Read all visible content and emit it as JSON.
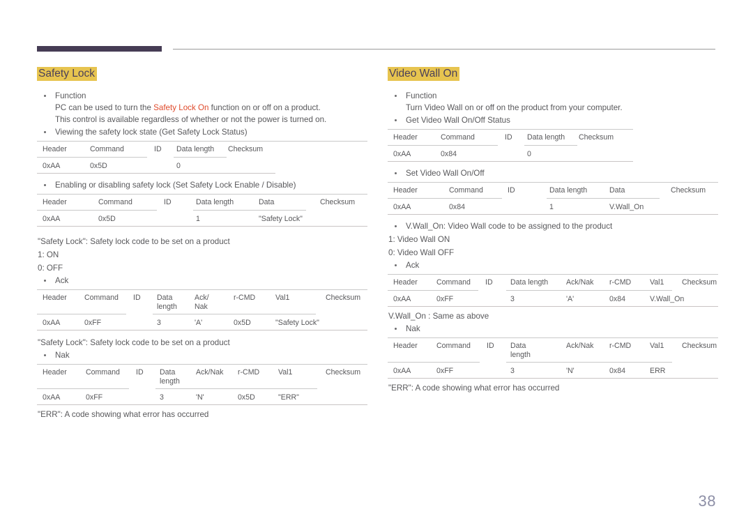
{
  "page": {
    "number": "38"
  },
  "left": {
    "heading": "Safety Lock",
    "function_label": "Function",
    "function_line1_a": "PC can be used to turn the ",
    "function_line1_hl": "Safety Lock On",
    "function_line1_b": " function on or off on a product.",
    "function_line2": "This control is available regardless of whether or not the power is turned on.",
    "get_label": "Viewing the safety lock state (Get Safety Lock Status)",
    "get_table": {
      "headers": [
        "Header",
        "Command",
        "ID",
        "Data length",
        "Checksum"
      ],
      "values": [
        "0xAA",
        "0x5D",
        "",
        "0",
        ""
      ]
    },
    "set_label": "Enabling or disabling safety lock (Set Safety Lock Enable / Disable)",
    "set_table": {
      "headers": [
        "Header",
        "Command",
        "ID",
        "Data length",
        "Data",
        "Checksum"
      ],
      "values": [
        "0xAA",
        "0x5D",
        "",
        "1",
        "\"Safety Lock\"",
        ""
      ]
    },
    "note_code_1": "\"Safety Lock\": Safety lock code to be set on a product",
    "note_on": "1: ON",
    "note_off": "0: OFF",
    "ack_label": "Ack",
    "ack_table": {
      "headers": [
        "Header",
        "Command",
        "ID",
        "Data\nlength",
        "Ack/\nNak",
        "r-CMD",
        "Val1",
        "Checksum"
      ],
      "values": [
        "0xAA",
        "0xFF",
        "",
        "3",
        "'A'",
        "0x5D",
        "\"Safety Lock\"",
        ""
      ]
    },
    "note_code_2": "\"Safety Lock\": Safety lock code to be set on a product",
    "nak_label": "Nak",
    "nak_table": {
      "headers": [
        "Header",
        "Command",
        "ID",
        "Data\nlength",
        "Ack/Nak",
        "r-CMD",
        "Val1",
        "Checksum"
      ],
      "values": [
        "0xAA",
        "0xFF",
        "",
        "3",
        "'N'",
        "0x5D",
        "\"ERR\"",
        ""
      ]
    },
    "note_err": "\"ERR\": A code showing what error has occurred"
  },
  "right": {
    "heading": "Video Wall On",
    "function_label": "Function",
    "function_line1": "Turn Video Wall on or off on the product from your computer.",
    "get_label": "Get Video Wall On/Off Status",
    "get_table": {
      "headers": [
        "Header",
        "Command",
        "ID",
        "Data length",
        "Checksum"
      ],
      "values": [
        "0xAA",
        "0x84",
        "",
        "0",
        ""
      ]
    },
    "set_label": "Set Video Wall On/Off",
    "set_table": {
      "headers": [
        "Header",
        "Command",
        "ID",
        "Data length",
        "Data",
        "Checksum"
      ],
      "values": [
        "0xAA",
        "0x84",
        "",
        "1",
        "V.Wall_On",
        ""
      ]
    },
    "vwall_label": "V.Wall_On: Video Wall code to be assigned to the product",
    "note_on": "1: Video Wall ON",
    "note_off": "0: Video Wall OFF",
    "ack_label": "Ack",
    "ack_table": {
      "headers": [
        "Header",
        "Command",
        "ID",
        "Data length",
        "Ack/Nak",
        "r-CMD",
        "Val1",
        "Checksum"
      ],
      "values": [
        "0xAA",
        "0xFF",
        "",
        "3",
        "'A'",
        "0x84",
        "V.Wall_On",
        ""
      ]
    },
    "note_same": "V.Wall_On : Same as above",
    "nak_label": "Nak",
    "nak_table": {
      "headers": [
        "Header",
        "Command",
        "ID",
        "Data\nlength",
        "Ack/Nak",
        "r-CMD",
        "Val1",
        "Checksum"
      ],
      "values": [
        "0xAA",
        "0xFF",
        "",
        "3",
        "'N'",
        "0x84",
        "ERR",
        ""
      ]
    },
    "note_err": "\"ERR\": A code showing what error has occurred"
  },
  "colors": {
    "heading_highlight": "#e7c44f",
    "heading_text": "#4a3f59",
    "accent_red": "#df4a2b",
    "topbar_chunk": "#463c54",
    "rule": "#c9c9c9",
    "body_text": "#58585b",
    "page_number": "#8d8fa6"
  }
}
